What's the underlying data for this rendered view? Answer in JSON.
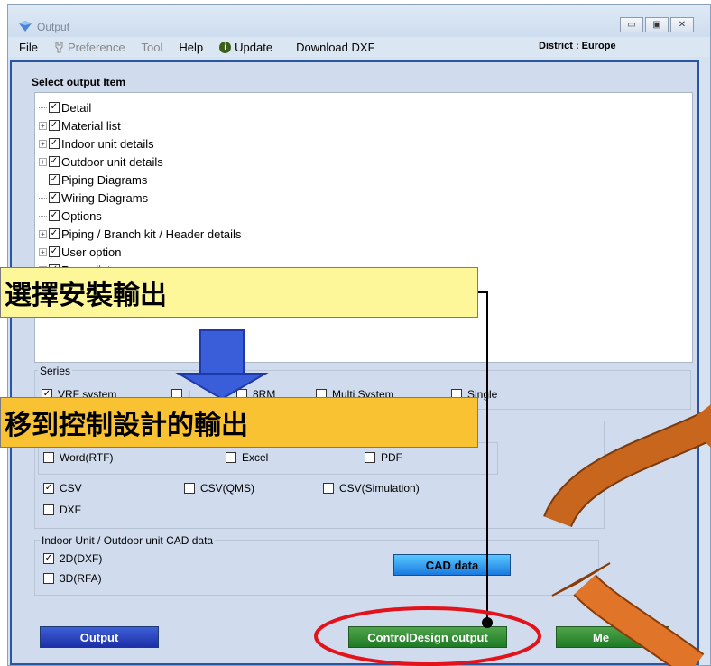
{
  "window": {
    "title": "Output",
    "icon": "app-diamond-icon",
    "controls": [
      "minimize-icon",
      "maximize-icon",
      "close-icon"
    ],
    "minimize_glyph": "▭",
    "maximize_glyph": "▣",
    "close_glyph": "✕"
  },
  "menu": {
    "file": "File",
    "preference": "Preference",
    "tool": "Tool",
    "help": "Help",
    "update": "Update",
    "update_icon_glyph": "i",
    "download_dxf": "Download DXF"
  },
  "district": "District : Europe",
  "select_output": {
    "title": "Select output Item",
    "items": [
      {
        "label": "Detail",
        "expandable": false
      },
      {
        "label": "Material list",
        "expandable": true
      },
      {
        "label": "Indoor unit details",
        "expandable": true
      },
      {
        "label": "Outdoor unit details",
        "expandable": true
      },
      {
        "label": "Piping Diagrams",
        "expandable": false
      },
      {
        "label": "Wiring Diagrams",
        "expandable": false
      },
      {
        "label": "Options",
        "expandable": false
      },
      {
        "label": "Piping / Branch kit / Header details",
        "expandable": true
      },
      {
        "label": "User option",
        "expandable": true
      },
      {
        "label": "Room list",
        "expandable": true
      }
    ]
  },
  "series": {
    "label": "Series",
    "options": [
      {
        "label": "VRF system",
        "checked": true
      },
      {
        "label": "L",
        "checked": false
      },
      {
        "label": "8RM",
        "checked": false
      },
      {
        "label": "Multi System",
        "checked": false
      },
      {
        "label": "Single",
        "checked": false
      }
    ]
  },
  "format": {
    "row1": [
      {
        "label": "Word(RTF)",
        "checked": false
      },
      {
        "label": "Excel",
        "checked": false
      },
      {
        "label": "PDF",
        "checked": false
      }
    ],
    "row2": [
      {
        "label": "CSV",
        "checked": true
      },
      {
        "label": "CSV(QMS)",
        "checked": false
      },
      {
        "label": "CSV(Simulation)",
        "checked": false
      }
    ],
    "row3": [
      {
        "label": "DXF",
        "checked": false
      }
    ]
  },
  "cad": {
    "label": "Indoor Unit / Outdoor unit CAD data",
    "options": [
      {
        "label": "2D(DXF)",
        "checked": true
      },
      {
        "label": "3D(RFA)",
        "checked": false
      }
    ],
    "button": "CAD data"
  },
  "buttons": {
    "output": "Output",
    "control_design": "ControlDesign output",
    "third": "Me"
  },
  "check_glyph": "✓",
  "expand_glyph": "+",
  "annotations": {
    "callout1": "選擇安裝輸出",
    "callout2": "移到控制設計的輸出",
    "colors": {
      "callout1_bg": "#fdf79a",
      "callout2_bg": "#f9c233",
      "arrow_blue": "#3a5ed9",
      "arrow_orange": "#e0752a",
      "arrow_brown": "#c9661e",
      "highlight_red": "#e3131b"
    }
  },
  "colors": {
    "frame_border": "#2a56a0",
    "panel_bg": "#d0dced",
    "btn_blue": "#2b46c4",
    "btn_green": "#2f8a32",
    "btn_cyan": "#2fa0f0"
  }
}
